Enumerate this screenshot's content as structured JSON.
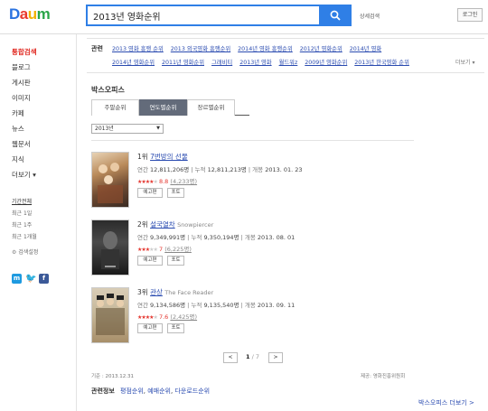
{
  "header": {
    "logo": "Daum",
    "search_value": "2013년 영화순위",
    "detail_search": "상세검색",
    "login": "로그인"
  },
  "sidebar": {
    "items": [
      {
        "label": "통합검색",
        "active": true
      },
      {
        "label": "블로그"
      },
      {
        "label": "게시판"
      },
      {
        "label": "이미지"
      },
      {
        "label": "카페"
      },
      {
        "label": "뉴스"
      },
      {
        "label": "웹문서"
      },
      {
        "label": "지식"
      },
      {
        "label": "더보기 ▾"
      }
    ],
    "period": {
      "title": "기간전체",
      "options": [
        "최근 1일",
        "최근 1주",
        "최근 1개월"
      ]
    },
    "settings": "검색설정"
  },
  "related": {
    "label": "관련",
    "row1": [
      "2013 영화 흥행 순위",
      "2013 외국영화 흥행순위",
      "2014년 영화 흥행순위",
      "2012년 영화순위",
      "2014년 영화"
    ],
    "row2": [
      "2014년 영화순위",
      "2011년 영화순위",
      "그래비티",
      "2013년 영화",
      "월드워z",
      "2009년 영화순위",
      "2013년 한국영화 순위"
    ],
    "more": "더보기 ▾"
  },
  "box_office": {
    "title": "박스오피스",
    "tabs": [
      "주말순위",
      "연도별순위",
      "장르별순위"
    ],
    "active_tab": 1,
    "year": "2013년",
    "movies": [
      {
        "rank": "1위",
        "title": "7번방의 선물",
        "original": "",
        "annual": "12,811,206명",
        "cumulative": "12,811,213명",
        "release": "2013. 01. 23",
        "stars": 4.4,
        "score": "8.8",
        "votes": "(4,233명)"
      },
      {
        "rank": "2위",
        "title": "설국열차",
        "original": "Snowpiercer",
        "annual": "9,349,991명",
        "cumulative": "9,350,194명",
        "release": "2013. 08. 01",
        "stars": 3.5,
        "score": "7",
        "votes": "(6,225명)"
      },
      {
        "rank": "3위",
        "title": "관상",
        "original": "The Face Reader",
        "annual": "9,134,586명",
        "cumulative": "9,135,540명",
        "release": "2013. 09. 11",
        "stars": 3.8,
        "score": "7.6",
        "votes": "(2,425명)"
      }
    ],
    "labels": {
      "annual": "연간",
      "cumulative": "누적",
      "release": "개봉",
      "trailer": "예고편",
      "photo": "포토"
    },
    "pager": {
      "current": "1",
      "total": "/ 7",
      "prev": "<",
      "next": ">"
    },
    "basis": "기준 : 2013.12.31",
    "source": "제공: 영화진흥위원회",
    "related_info_label": "관련정보",
    "related_info_links": [
      "평점순위",
      "예매순위",
      "다운로드순위"
    ],
    "more": "박스오피스 더보기 >"
  }
}
